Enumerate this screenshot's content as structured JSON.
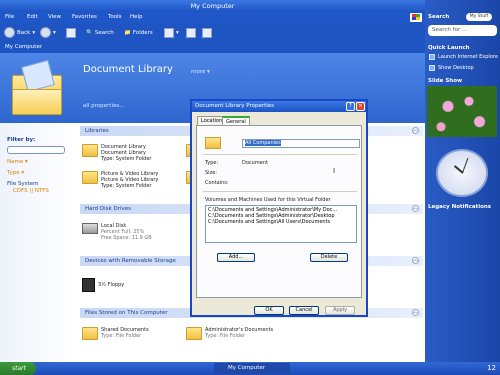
{
  "window": {
    "title": "My Computer",
    "menu": [
      "File",
      "Edit",
      "View",
      "Favorites",
      "Tools",
      "Help"
    ],
    "toolbar": {
      "back": "Back",
      "search": "Search",
      "folders": "Folders"
    },
    "address": "My Computer"
  },
  "header": {
    "title": "Document Library",
    "more": "more",
    "all_properties": "all properties..."
  },
  "left_pane": {
    "filter_label": "Filter by:",
    "name": "Name",
    "type": "Type",
    "file_system": "File System",
    "fs_values": "CDFS || NTFS"
  },
  "sections": {
    "libraries": "Libraries",
    "hard_disk": "Hard Disk Drives",
    "removable": "Devices with Removable Storage",
    "stored": "Files Stored on This Computer"
  },
  "items": {
    "doc_lib": {
      "l1": "Document Library",
      "l2": "Document Library",
      "l3": "Type: System Folder"
    },
    "pic_lib": {
      "l1": "Picture & Video Library",
      "l2": "Picture & Video Library",
      "l3": "Type: System Folder"
    },
    "local_disk": {
      "l1": "Local Disk",
      "l2": "Percent Full: 25%",
      "l3": "Free Space: 11.9 GB"
    },
    "floppy": {
      "l1": "3½ Floppy"
    },
    "shared_docs": {
      "l1": "Shared Documents",
      "l2": "Type: File Folder"
    },
    "admin_docs": {
      "l1": "Administrator's Documents",
      "l2": "Type: File Folder"
    }
  },
  "dialog": {
    "title": "Document Library Properties",
    "tabs": [
      "Location",
      "General"
    ],
    "name_value": "All Companies",
    "type_label": "Type:",
    "type_value": "Document",
    "size_label": "Size:",
    "contains_label": "Contains:",
    "volumes_label": "Volumes and Machines Used for this Virtual Folder",
    "volumes": [
      "C:\\Documents and Settings\\Administrator\\My Doc...",
      "C:\\Documents and Settings\\Administrator\\Desktop",
      "C:\\Documents and Settings\\All Users\\Documents"
    ],
    "add": "Add...",
    "delete": "Delete",
    "ok": "OK",
    "cancel": "Cancel",
    "apply": "Apply"
  },
  "sidebar": {
    "search_label": "Search",
    "search_badge": "My Stuff",
    "search_placeholder": "Search for ...",
    "quick_launch": "Quick Launch",
    "ql_items": [
      "Launch Internet Explorer",
      "Show Desktop"
    ],
    "slide_show": "Slide Show",
    "legacy": "Legacy Notifications"
  },
  "taskbar": {
    "start": "start",
    "task": "My Computer",
    "time": "12"
  }
}
